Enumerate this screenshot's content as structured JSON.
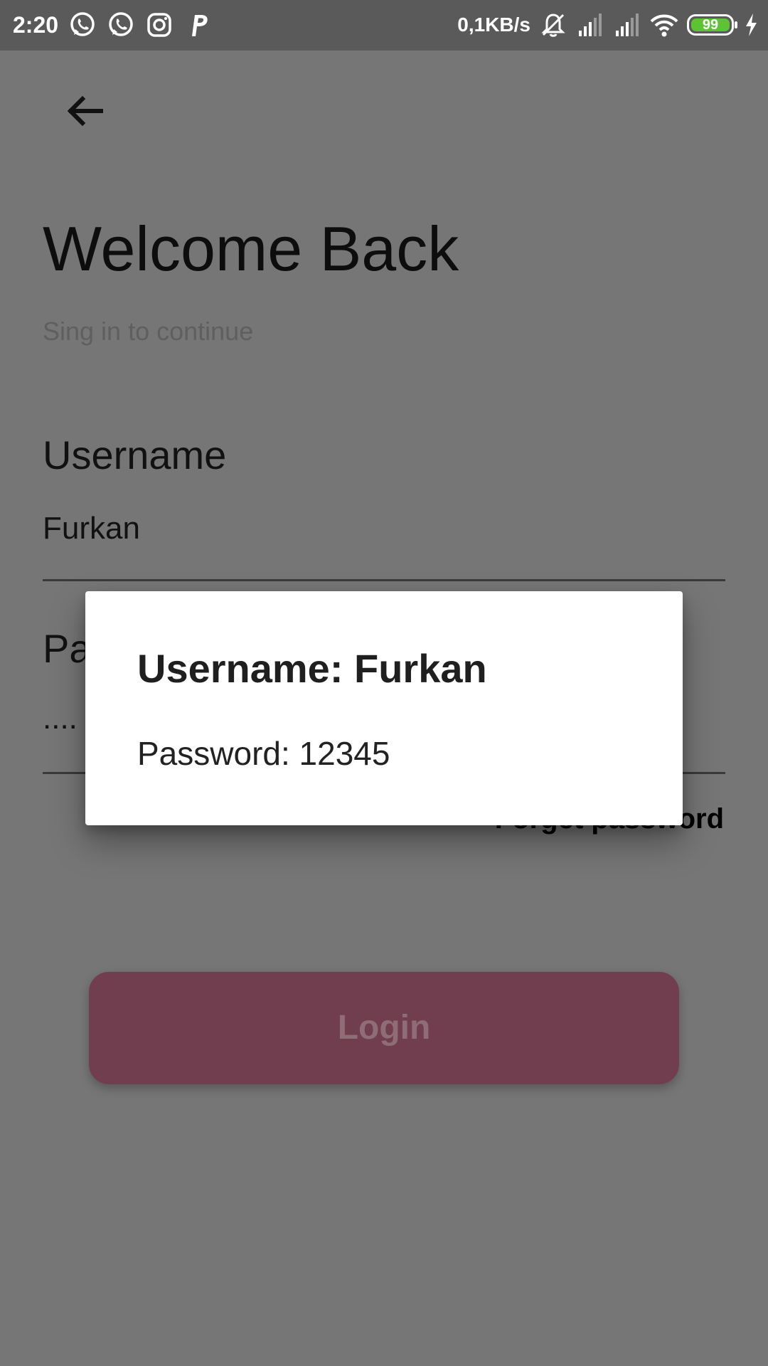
{
  "status_bar": {
    "time": "2:20",
    "speed": "0,1KB/s",
    "battery_level": "99",
    "left_icons": [
      "whatsapp-icon",
      "whatsapp-icon",
      "instagram-icon",
      "p-app-icon"
    ],
    "right_icons": [
      "mute-bell-icon",
      "signal-icon",
      "signal-icon",
      "wifi-icon",
      "battery-icon",
      "charging-icon"
    ]
  },
  "page": {
    "back_icon": "arrow-back-icon",
    "title": "Welcome Back",
    "subtitle": "Sing in to continue",
    "username_label": "Username",
    "username_value": "Furkan",
    "password_label": "Pa",
    "password_value": "....",
    "forgot_label": "Forget password",
    "login_label": "Login"
  },
  "dialog": {
    "title": "Username: Furkan",
    "content": "Password: 12345"
  },
  "colors": {
    "scrim_background": "#767676",
    "status_bar": "#5a5a5a",
    "login_button": "#713e50",
    "battery_fill": "#5cc335",
    "dialog_background": "#ffffff"
  }
}
